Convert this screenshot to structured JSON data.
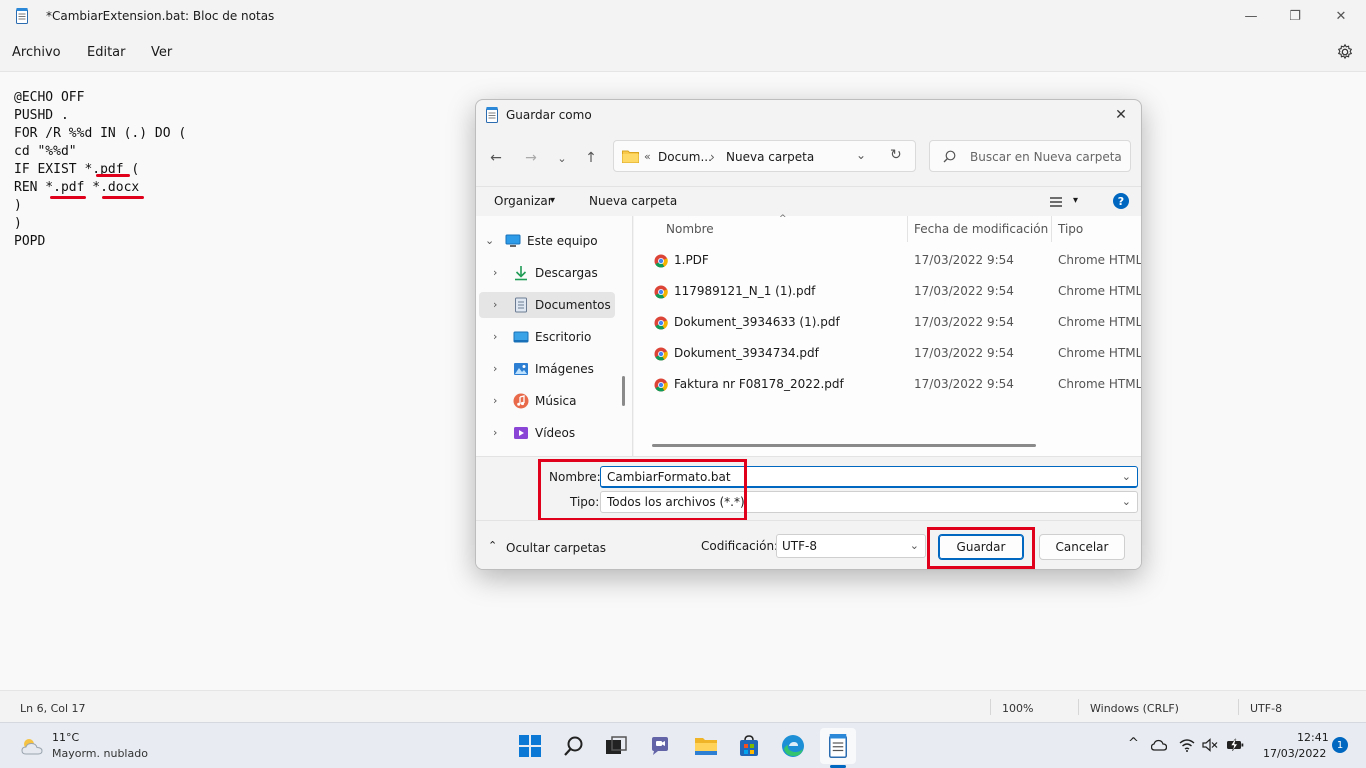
{
  "window": {
    "title": "*CambiarExtension.bat: Bloc de notas",
    "minimize": "—",
    "maximize": "❐",
    "close": "✕"
  },
  "menu": {
    "file": "Archivo",
    "edit": "Editar",
    "view": "Ver"
  },
  "editor": {
    "lines": [
      "@ECHO OFF",
      "PUSHD .",
      "FOR /R %%d IN (.) DO (",
      "cd \"%%d\"",
      "IF EXIST *.pdf (",
      "REN *.pdf *.docx",
      ")",
      ")",
      "POPD"
    ]
  },
  "status": {
    "position": "Ln 6, Col 17",
    "zoom": "100%",
    "line_ending": "Windows (CRLF)",
    "encoding": "UTF-8"
  },
  "dialog": {
    "title": "Guardar como",
    "close": "✕",
    "nav": {
      "back": "←",
      "forward": "→",
      "recent": "⌄",
      "up": "↑"
    },
    "address": {
      "chevrons": "«",
      "parent": "Docum...",
      "separator": "›",
      "current": "Nueva carpeta",
      "dropdown": "⌄",
      "refresh": "↻"
    },
    "search_placeholder": "Buscar en Nueva carpeta",
    "toolbar": {
      "organize": "Organizar",
      "organize_caret": "▾",
      "new_folder": "Nueva carpeta",
      "view_caret": "▾",
      "help": "?"
    },
    "nav_pane": [
      {
        "label": "Este equipo",
        "chevron": "⌄"
      },
      {
        "label": "Descargas",
        "chevron": "›"
      },
      {
        "label": "Documentos",
        "chevron": "›"
      },
      {
        "label": "Escritorio",
        "chevron": "›"
      },
      {
        "label": "Imágenes",
        "chevron": "›"
      },
      {
        "label": "Música",
        "chevron": "›"
      },
      {
        "label": "Vídeos",
        "chevron": "›"
      }
    ],
    "columns": {
      "name": "Nombre",
      "date": "Fecha de modificación",
      "type": "Tipo"
    },
    "files": [
      {
        "name": "1.PDF",
        "date": "17/03/2022 9:54",
        "type": "Chrome HTML D"
      },
      {
        "name": "117989121_N_1 (1).pdf",
        "date": "17/03/2022 9:54",
        "type": "Chrome HTML D"
      },
      {
        "name": "Dokument_3934633 (1).pdf",
        "date": "17/03/2022 9:54",
        "type": "Chrome HTML D"
      },
      {
        "name": "Dokument_3934734.pdf",
        "date": "17/03/2022 9:54",
        "type": "Chrome HTML D"
      },
      {
        "name": "Faktura nr F08178_2022.pdf",
        "date": "17/03/2022 9:54",
        "type": "Chrome HTML D"
      }
    ],
    "filename_label": "Nombre:",
    "filename_value": "CambiarFormato.bat",
    "filetype_label": "Tipo:",
    "filetype_value": "Todos los archivos  (*.*)",
    "hide_folders": "Ocultar carpetas",
    "hide_caret": "⌃",
    "encoding_label": "Codificación:",
    "encoding_value": "UTF-8",
    "save": "Guardar",
    "cancel": "Cancelar"
  },
  "taskbar": {
    "weather_temp": "11°C",
    "weather_desc": "Mayorm. nublado",
    "tray_chevron": "^",
    "time": "12:41",
    "date": "17/03/2022",
    "notifications": "1"
  }
}
